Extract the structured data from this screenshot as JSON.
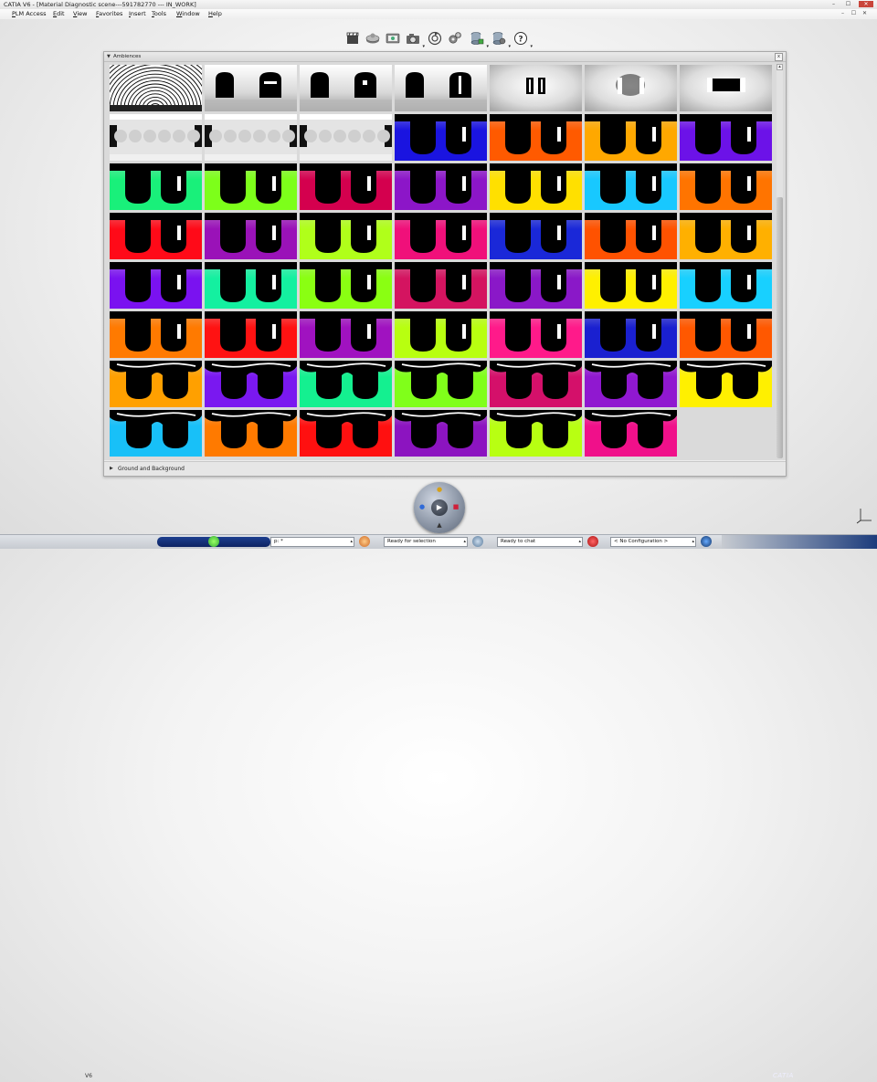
{
  "window": {
    "title": "CATIA V6 - [Material Diagnostic scene---591782770 --- IN_WORK]",
    "controls": [
      "–",
      "☐",
      "✕"
    ]
  },
  "menubar": {
    "items": [
      "PLM Access",
      "Edit",
      "View",
      "Favorites",
      "Insert",
      "Tools",
      "Window",
      "Help"
    ],
    "mdi_controls": [
      "–",
      "☐",
      "✕"
    ]
  },
  "toolbar": {
    "icons": [
      "clapboard-icon",
      "disk-plate-icon",
      "render-screen-icon",
      "camera-icon",
      "refresh-target-icon",
      "gears-icon",
      "database-icon",
      "database-gear-icon",
      "help-icon"
    ]
  },
  "panel": {
    "title": "Ambiences",
    "close_label": "x",
    "ground_label": "Ground and Background",
    "scroll_up": "▴"
  },
  "tiles": [
    {
      "style": "rays",
      "color": "#000000"
    },
    {
      "style": "windows1",
      "color": "#000000"
    },
    {
      "style": "windows2",
      "color": "#000000"
    },
    {
      "style": "windows3",
      "color": "#000000"
    },
    {
      "style": "bars",
      "color": "#000000"
    },
    {
      "style": "bars2",
      "color": "#000000"
    },
    {
      "style": "bars3",
      "color": "#000000"
    },
    {
      "style": "soft",
      "color": "#d8d8d8"
    },
    {
      "style": "soft",
      "color": "#d8d8d8"
    },
    {
      "style": "soft",
      "color": "#d8d8d8"
    },
    {
      "style": "cup",
      "color": "#1a14e0"
    },
    {
      "style": "cup",
      "color": "#ff5a00"
    },
    {
      "style": "cup",
      "color": "#ffa800"
    },
    {
      "style": "cup",
      "color": "#6c12e8"
    },
    {
      "style": "cup",
      "color": "#19f07a"
    },
    {
      "style": "cup",
      "color": "#7dff1a"
    },
    {
      "style": "cup",
      "color": "#d4004e"
    },
    {
      "style": "cup",
      "color": "#8c16c8"
    },
    {
      "style": "cup",
      "color": "#ffe000"
    },
    {
      "style": "cup",
      "color": "#18c8ff"
    },
    {
      "style": "cup",
      "color": "#ff7400"
    },
    {
      "style": "cup",
      "color": "#ff0a18"
    },
    {
      "style": "cup",
      "color": "#9a12b8"
    },
    {
      "style": "cup",
      "color": "#b0ff1a"
    },
    {
      "style": "cup",
      "color": "#f0107a"
    },
    {
      "style": "cup",
      "color": "#1a28d8"
    },
    {
      "style": "cup",
      "color": "#ff5200"
    },
    {
      "style": "cup",
      "color": "#ffb000"
    },
    {
      "style": "cup",
      "color": "#7a12f0"
    },
    {
      "style": "cup",
      "color": "#14f0a0"
    },
    {
      "style": "cup",
      "color": "#8aff12"
    },
    {
      "style": "cup",
      "color": "#d41460"
    },
    {
      "style": "cup",
      "color": "#8a18c8"
    },
    {
      "style": "cup",
      "color": "#fff000"
    },
    {
      "style": "cup",
      "color": "#18d0ff"
    },
    {
      "style": "cup",
      "color": "#ff7a00"
    },
    {
      "style": "cup",
      "color": "#ff1212"
    },
    {
      "style": "cup",
      "color": "#a012c0"
    },
    {
      "style": "cup",
      "color": "#b8ff10"
    },
    {
      "style": "cup",
      "color": "#ff1a8a"
    },
    {
      "style": "cup",
      "color": "#1a20d0"
    },
    {
      "style": "cup",
      "color": "#ff5800"
    },
    {
      "style": "wave",
      "color": "#ffa000"
    },
    {
      "style": "wave",
      "color": "#7a18f0"
    },
    {
      "style": "wave",
      "color": "#14f090"
    },
    {
      "style": "wave",
      "color": "#80ff1a"
    },
    {
      "style": "wave",
      "color": "#d4106a"
    },
    {
      "style": "wave",
      "color": "#9018d0"
    },
    {
      "style": "wave",
      "color": "#fff000"
    },
    {
      "style": "wave",
      "color": "#18c0f8"
    },
    {
      "style": "wave",
      "color": "#ff7a00"
    },
    {
      "style": "wave",
      "color": "#ff1010"
    },
    {
      "style": "wave",
      "color": "#8c14c0"
    },
    {
      "style": "wave",
      "color": "#b8ff12"
    },
    {
      "style": "wave",
      "color": "#f0108a"
    }
  ],
  "statusbar": {
    "command_value": "p: *",
    "selection_status": "Ready for selection",
    "chat_status": "Ready to chat",
    "configuration": "< No Configuration >",
    "brand_v6": "V6",
    "brand": "CATIA"
  }
}
